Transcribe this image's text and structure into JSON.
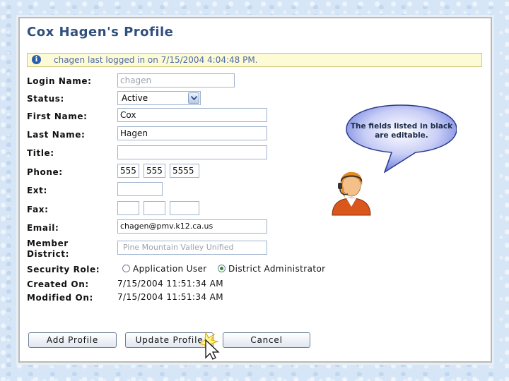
{
  "profile": {
    "title": "Cox Hagen's Profile",
    "info_message": "chagen last logged in on 7/15/2004 4:04:48 PM.",
    "labels": {
      "login_name": "Login Name:",
      "status": "Status:",
      "first_name": "First Name:",
      "last_name": "Last Name:",
      "title": "Title:",
      "phone": "Phone:",
      "ext": "Ext:",
      "fax": "Fax:",
      "email": "Email:",
      "member_district_1": "Member",
      "member_district_2": "District:",
      "security_role": "Security Role:",
      "created_on": "Created On:",
      "modified_on": "Modified On:"
    },
    "fields": {
      "login_name": "chagen",
      "status": "Active",
      "first_name": "Cox",
      "last_name": "Hagen",
      "title": "",
      "phone_area": "555",
      "phone_prefix": "555",
      "phone_line": "5555",
      "ext": "",
      "fax_area": "",
      "fax_prefix": "",
      "fax_line": "",
      "email": "chagen@pmv.k12.ca.us",
      "member_district": "Pine Mountain Valley Unified"
    },
    "security_role": {
      "options": [
        "Application User",
        "District Administrator"
      ],
      "selected": "District Administrator"
    },
    "created_on": "7/15/2004 11:51:34 AM",
    "modified_on": "7/15/2004 11:51:34 AM",
    "buttons": {
      "add": "Add Profile",
      "update": "Update Profile",
      "cancel": "Cancel"
    },
    "callout": "The fields listed in black are editable."
  },
  "colors": {
    "title": "#2f4f7f",
    "info_bg": "#fdfbd6",
    "info_text": "#4d6aa8",
    "bubble": "#7b88e0"
  },
  "icons": {
    "info": "info-icon",
    "status_dropdown": "chevron-down-icon",
    "agent": "support-agent-icon",
    "cursor": "arrow-cursor-icon"
  }
}
